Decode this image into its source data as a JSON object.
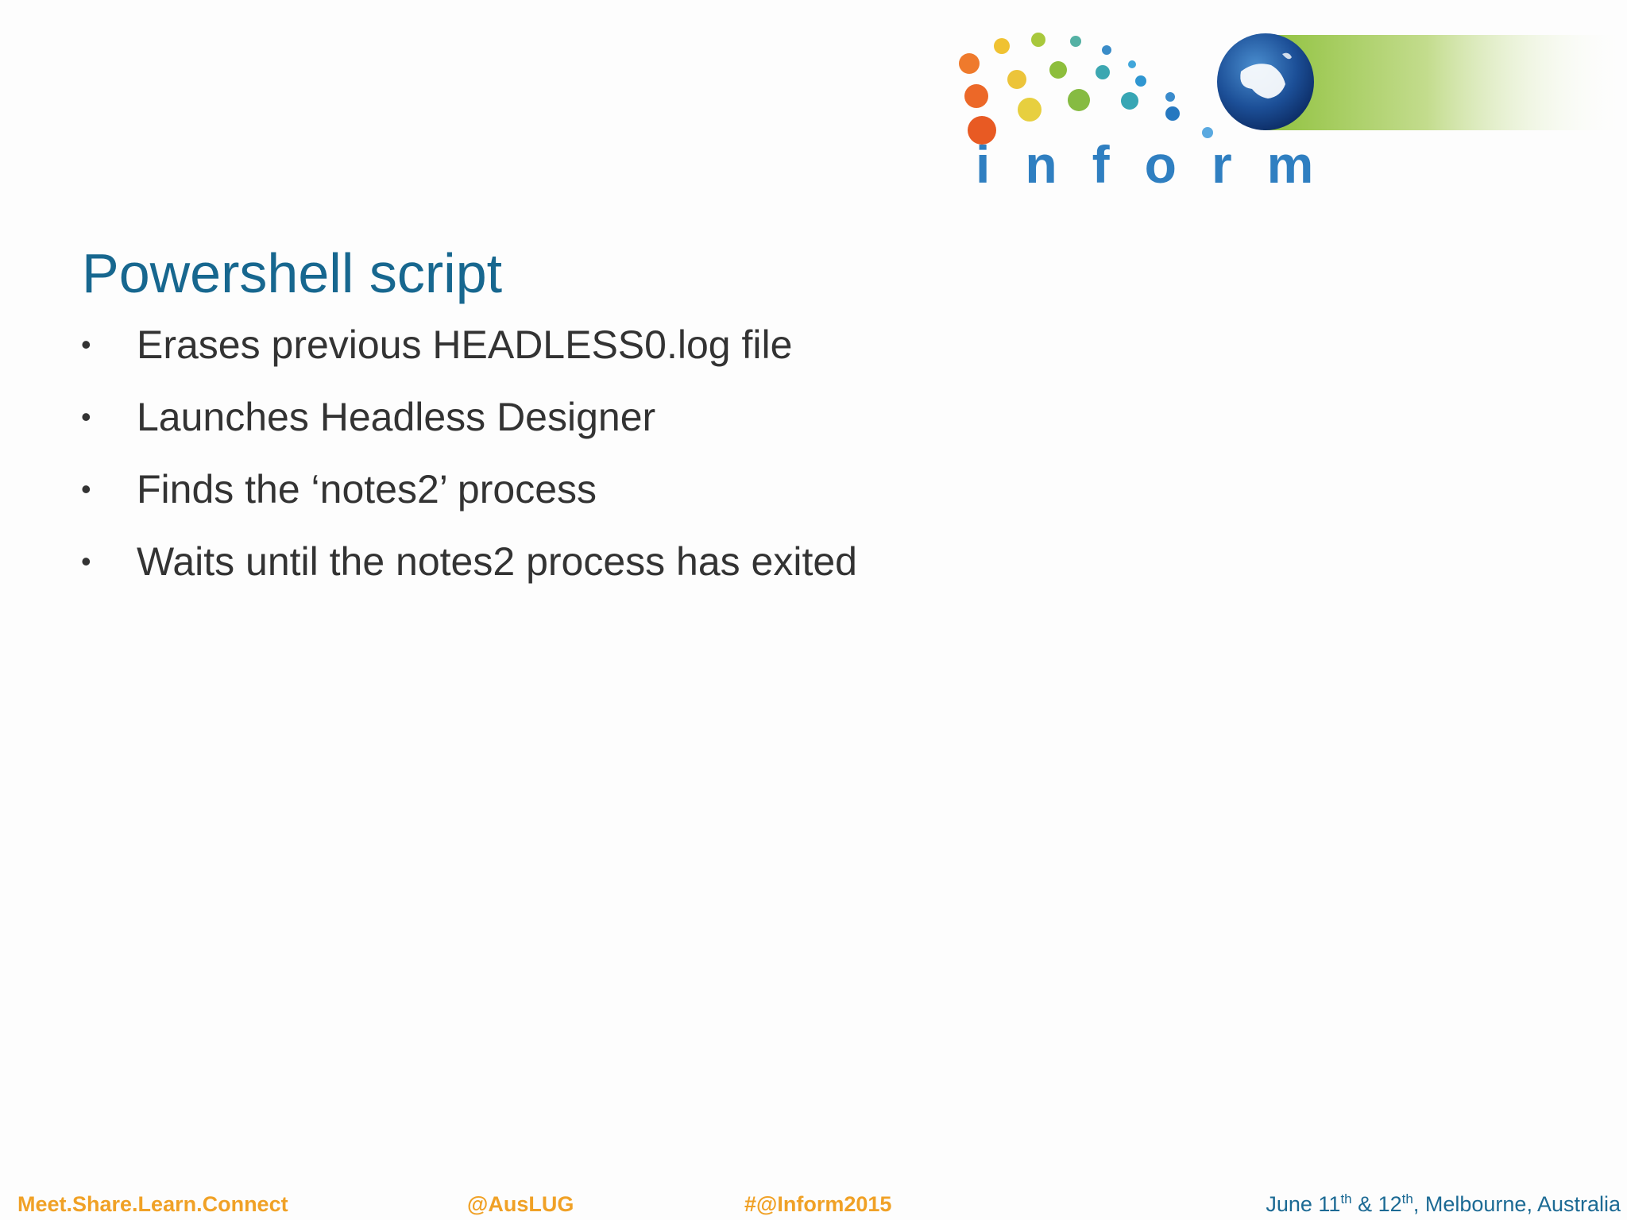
{
  "logo": {
    "text": "inform"
  },
  "slide": {
    "title": "Powershell script",
    "bullets": [
      "Erases previous HEADLESS0.log file",
      "Launches Headless Designer",
      "Finds the ‘notes2’ process",
      "Waits until the notes2 process has exited"
    ]
  },
  "footer": {
    "tagline": "Meet.Share.Learn.Connect",
    "twitter": "@AusLUG",
    "hashtag": "#@Inform2015",
    "event_date_1": "June 11",
    "sup_1": "th",
    "event_date_amp": " & 12",
    "sup_2": "th",
    "event_location": ", Melbourne, Australia"
  },
  "colors": {
    "title": "#17678f",
    "body_text": "#333333",
    "footer_orange": "#f0a126",
    "footer_blue": "#1c6a94"
  }
}
